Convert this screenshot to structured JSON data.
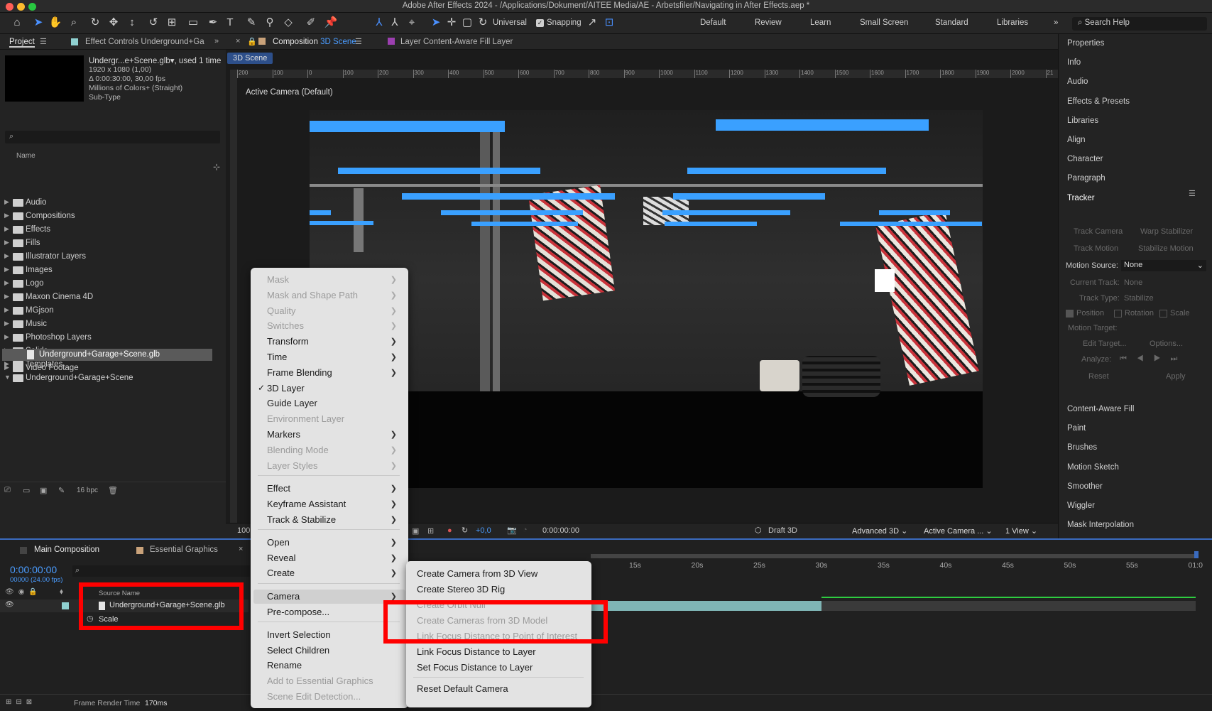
{
  "window": {
    "title": "Adobe After Effects 2024 - /Applications/Dokument/AITEE Media/AE - Arbetsfiler/Navigating in After Effects.aep *"
  },
  "toolbar": {
    "universal_label": "Universal",
    "snapping_label": "Snapping",
    "workspaces": [
      "Default",
      "Review",
      "Learn",
      "Small Screen",
      "Standard",
      "Libraries"
    ],
    "search_help": "Search Help"
  },
  "project_panel": {
    "tab_project": "Project",
    "tab_effect_controls": "Effect Controls Underground+Ga",
    "item_name": "Undergr...e+Scene.glb",
    "item_used": ", used 1 time",
    "item_info": [
      "1920 x 1080 (1,00)",
      "Δ 0:00:30:00, 30,00 fps",
      "Millions of Colors+ (Straight)",
      "Sub-Type"
    ],
    "name_header": "Name",
    "folders": [
      "Audio",
      "Compositions",
      "Effects",
      "Fills",
      "Illustrator Layers",
      "Images",
      "Logo",
      "Maxon Cinema 4D",
      "MGjson",
      "Music",
      "Photoshop Layers",
      "Solids",
      "Templates",
      "Underground+Garage+Scene"
    ],
    "selected_file": "Underground+Garage+Scene.glb",
    "last_folder": "Video Footage",
    "bpc": "16 bpc"
  },
  "composition": {
    "tab_prefix": "Composition",
    "tab_name": "3D Scene",
    "layer_tab": "Layer Content-Aware Fill Layer",
    "breadcrumb": "3D Scene",
    "camera_label": "Active Camera (Default)",
    "ruler_labels": [
      "200",
      "100",
      "0",
      "100",
      "200",
      "300",
      "400",
      "500",
      "600",
      "700",
      "800",
      "900",
      "1000",
      "1100",
      "1200",
      "1300",
      "1400",
      "1500",
      "1600",
      "1700",
      "1800",
      "1900",
      "2000",
      "21"
    ],
    "footer": {
      "zoom": "100",
      "exposure": "+0,0",
      "timecode": "0:00:00:00",
      "renderer": "Draft 3D",
      "engine": "Advanced 3D",
      "camera": "Active Camera ...",
      "views": "1 View"
    }
  },
  "right_panels": {
    "items_top": [
      "Properties",
      "Info",
      "Audio",
      "Effects & Presets",
      "Libraries",
      "Align",
      "Character",
      "Paragraph",
      "Tracker"
    ],
    "tracker": {
      "track_camera": "Track Camera",
      "warp_stabilizer": "Warp Stabilizer",
      "track_motion": "Track Motion",
      "stabilize_motion": "Stabilize Motion",
      "motion_source_label": "Motion Source:",
      "motion_source_value": "None",
      "current_track_label": "Current Track:",
      "current_track_value": "None",
      "track_type_label": "Track Type:",
      "track_type_value": "Stabilize",
      "position": "Position",
      "rotation": "Rotation",
      "scale": "Scale",
      "motion_target": "Motion Target:",
      "edit_target": "Edit Target...",
      "options": "Options...",
      "analyze": "Analyze:",
      "reset": "Reset",
      "apply": "Apply"
    },
    "items_bottom": [
      "Content-Aware Fill",
      "Paint",
      "Brushes",
      "Motion Sketch",
      "Smoother",
      "Wiggler",
      "Mask Interpolation"
    ]
  },
  "timeline": {
    "tab_main": "Main Composition",
    "tab_essential": "Essential Graphics",
    "timecode": "0:00:00:00",
    "frames": "00000 (24.00 fps)",
    "source_name_header": "Source Name",
    "layer_name": "Underground+Garage+Scene.glb",
    "property": "Scale",
    "ruler": [
      "15s",
      "20s",
      "25s",
      "30s",
      "35s",
      "40s",
      "45s",
      "50s",
      "55s",
      "01:0"
    ],
    "frame_render_label": "Frame Render Time",
    "frame_render_value": "170ms"
  },
  "context_menu": {
    "items": [
      {
        "label": "Mask",
        "disabled": true,
        "sub": true
      },
      {
        "label": "Mask and Shape Path",
        "disabled": true,
        "sub": true
      },
      {
        "label": "Quality",
        "disabled": true,
        "sub": true
      },
      {
        "label": "Switches",
        "disabled": true,
        "sub": true
      },
      {
        "label": "Transform",
        "disabled": false,
        "sub": true
      },
      {
        "label": "Time",
        "disabled": false,
        "sub": true
      },
      {
        "label": "Frame Blending",
        "disabled": false,
        "sub": true
      },
      {
        "label": "3D Layer",
        "disabled": false,
        "sub": false,
        "checked": true
      },
      {
        "label": "Guide Layer",
        "disabled": false,
        "sub": false
      },
      {
        "label": "Environment Layer",
        "disabled": true,
        "sub": false
      },
      {
        "label": "Markers",
        "disabled": false,
        "sub": true
      },
      {
        "label": "Blending Mode",
        "disabled": true,
        "sub": true
      },
      {
        "label": "Layer Styles",
        "disabled": true,
        "sub": true
      },
      {
        "label": "Effect",
        "disabled": false,
        "sub": true
      },
      {
        "label": "Keyframe Assistant",
        "disabled": false,
        "sub": true
      },
      {
        "label": "Track & Stabilize",
        "disabled": false,
        "sub": true
      },
      {
        "label": "Open",
        "disabled": false,
        "sub": true
      },
      {
        "label": "Reveal",
        "disabled": false,
        "sub": true
      },
      {
        "label": "Create",
        "disabled": false,
        "sub": true
      },
      {
        "label": "Camera",
        "disabled": false,
        "sub": true
      },
      {
        "label": "Pre-compose...",
        "disabled": false,
        "sub": false
      },
      {
        "label": "Invert Selection",
        "disabled": false,
        "sub": false
      },
      {
        "label": "Select Children",
        "disabled": false,
        "sub": false
      },
      {
        "label": "Rename",
        "disabled": false,
        "sub": false
      },
      {
        "label": "Add to Essential Graphics",
        "disabled": true,
        "sub": false
      },
      {
        "label": "Scene Edit Detection...",
        "disabled": true,
        "sub": false
      }
    ]
  },
  "camera_submenu": {
    "items": [
      {
        "label": "Create Camera from 3D View",
        "disabled": false
      },
      {
        "label": "Create Stereo 3D Rig",
        "disabled": false
      },
      {
        "label": "Create Orbit Null",
        "disabled": true
      },
      {
        "label": "Create Cameras from 3D Model",
        "disabled": true
      },
      {
        "label": "Link Focus Distance to Point of Interest",
        "disabled": true
      },
      {
        "label": "Link Focus Distance to Layer",
        "disabled": false
      },
      {
        "label": "Set Focus Distance to Layer",
        "disabled": false
      },
      {
        "label": "Reset Default Camera",
        "disabled": false
      }
    ]
  },
  "colors": {
    "accent_blue": "#3aa0ff",
    "highlight_red": "#ff0000",
    "menu_bg": "#e3e3e3"
  }
}
